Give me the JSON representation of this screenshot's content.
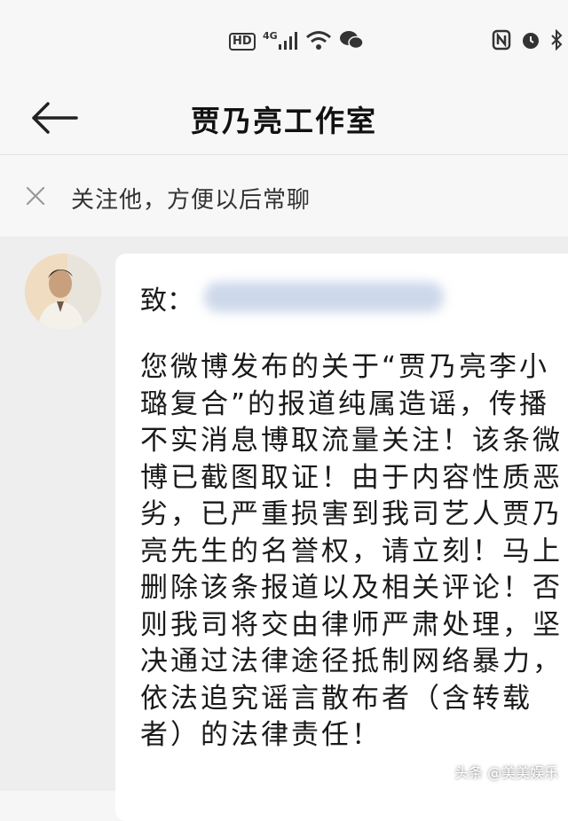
{
  "status_bar": {
    "network_badge": "HD",
    "signal_label": "4G"
  },
  "header": {
    "title": "贾乃亮工作室"
  },
  "follow_banner": {
    "text": "关注他，方便以后常聊"
  },
  "message": {
    "greeting": "致：",
    "body_lines": [
      "您微博发布的关于“贾乃亮李小",
      "璐复合”的报道纯属造谣，传播",
      "不实消息博取流量关注！该条微",
      "博已截图取证！由于内容性质恶",
      "劣，已严重损害到我司艺人贾乃",
      "亮先生的名誉权，请立刻！马上",
      "删除该条报道以及相关评论！否",
      "则我司将交由律师严肃处理，坚",
      "决通过法律途径抵制网络暴力，",
      "依法追究谣言散布者（含转载",
      "者）的法律责任！"
    ]
  },
  "watermark": {
    "text": "头条 @美美娱乐"
  },
  "icons": {
    "back": "arrow-left-icon",
    "dismiss": "close-icon",
    "signal": "signal-icon",
    "wifi": "wifi-icon",
    "wechat": "wechat-icon",
    "nfc": "nfc-icon",
    "alarm": "alarm-icon",
    "bluetooth": "bluetooth-icon"
  }
}
